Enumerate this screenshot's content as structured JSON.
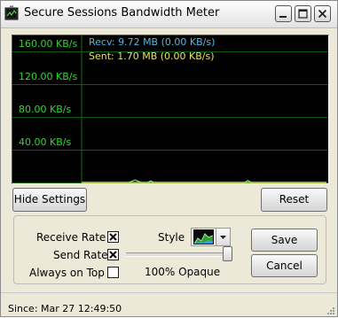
{
  "window": {
    "title": "Secure Sessions Bandwidth Meter",
    "controls": [
      "minimize",
      "maximize",
      "close"
    ]
  },
  "graph": {
    "legend": {
      "recv": "Recv: 9.72 MB (0.00 KB/s)",
      "sent": "Sent: 1.70 MB (0.00 KB/s)"
    },
    "colors": {
      "background": "#000000",
      "grid": "#0d5c0d",
      "axis_labels": "#35d535",
      "recv": "#59b6dc",
      "sent": "#e6e656",
      "trace": "#6fe06f"
    }
  },
  "chart_data": {
    "type": "area",
    "ytick_labels": [
      "160.00 KB/s",
      "120.00 KB/s",
      "80.00 KB/s",
      "40.00 KB/s"
    ],
    "yticks": [
      160,
      120,
      80,
      40
    ],
    "ylim": [
      0,
      180
    ],
    "series": [
      {
        "name": "Recv",
        "values": [
          0,
          0,
          0,
          0,
          0,
          0,
          0,
          0,
          0,
          0,
          0,
          0,
          0,
          0,
          0,
          0,
          1.5,
          3,
          1.5,
          0,
          0,
          0,
          2,
          0,
          0,
          0,
          0,
          0,
          0,
          0,
          0,
          0,
          0,
          0,
          0,
          0,
          0,
          0,
          0,
          0,
          0,
          0,
          0,
          0,
          0,
          0,
          0,
          0,
          0,
          0,
          0,
          0,
          0,
          2.5,
          0,
          0,
          0,
          0,
          0,
          0,
          0,
          0,
          0,
          0,
          0,
          0,
          0,
          0,
          0,
          0,
          0,
          0,
          0,
          0,
          0,
          0,
          0,
          0,
          0
        ]
      },
      {
        "name": "Sent",
        "values": [
          0,
          0,
          0,
          0,
          0,
          0,
          0,
          0,
          0,
          0,
          0,
          0,
          0,
          0,
          0,
          0,
          0,
          0,
          0,
          0,
          0,
          0,
          0,
          0,
          0,
          0,
          0,
          0,
          0,
          0,
          0,
          0,
          0,
          0,
          0,
          0,
          0,
          0,
          0,
          0,
          0,
          0,
          0,
          0,
          0,
          0,
          0,
          0,
          0,
          0,
          0,
          0,
          0,
          0,
          0,
          0,
          0,
          0,
          0,
          0,
          0,
          0,
          0,
          0,
          0,
          0,
          0,
          0,
          0,
          0,
          0,
          0,
          0,
          0,
          0,
          0,
          0,
          0,
          0
        ]
      }
    ],
    "grid": true
  },
  "buttons": {
    "hide_settings": "Hide Settings",
    "reset": "Reset",
    "save": "Save",
    "cancel": "Cancel"
  },
  "settings": {
    "receive_rate": {
      "label": "Receive Rate",
      "checked": true
    },
    "send_rate": {
      "label": "Send Rate",
      "checked": true
    },
    "always_on_top": {
      "label": "Always on Top",
      "checked": false
    },
    "style_label": "Style",
    "style_icon": "area-chart-icon",
    "opacity_label": "100% Opaque",
    "opacity_percent": 100
  },
  "status": {
    "since": "Since: Mar 27 12:49:50"
  }
}
